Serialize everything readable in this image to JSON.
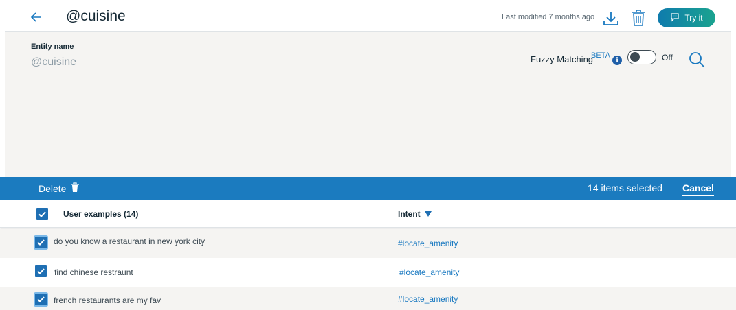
{
  "header": {
    "title": "@cuisine",
    "last_modified": "Last modified 7 months ago",
    "try_label": "Try it"
  },
  "entity": {
    "label": "Entity name",
    "value": "@cuisine"
  },
  "fuzzy": {
    "label": "Fuzzy Matching",
    "beta": "BETA",
    "info": "i",
    "state": "Off"
  },
  "action_bar": {
    "delete_label": "Delete",
    "selected_text": "14 items selected",
    "cancel_label": "Cancel"
  },
  "table": {
    "col_examples": "User examples (14)",
    "col_intent": "Intent",
    "rows": [
      {
        "example": "do you know a restaurant in new york city",
        "intent": "#locate_amenity"
      },
      {
        "example": "find chinese restraunt",
        "intent": "#locate_amenity"
      },
      {
        "example": "french restaurants are my fav",
        "intent": "#locate_amenity"
      }
    ]
  },
  "colors": {
    "accent": "#1b7bbf",
    "checkbox": "#1f6fb3",
    "link": "#1878c0",
    "panel_bg": "#f5f4f2"
  },
  "icons": [
    "back-arrow-icon",
    "download-icon",
    "trash-icon",
    "chat-icon",
    "info-icon",
    "search-icon",
    "checkmark-icon",
    "caret-down-icon"
  ]
}
